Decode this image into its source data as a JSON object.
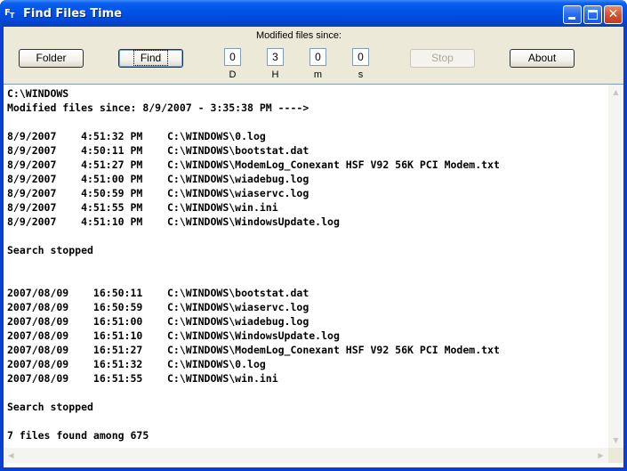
{
  "window": {
    "title": "Find Files Time",
    "icon": "app-icon",
    "controls": [
      "minimize-icon",
      "maximize-icon",
      "close-icon"
    ]
  },
  "toolbar": {
    "since_label": "Modified files since:",
    "folder_label": "Folder",
    "find_label": "Find",
    "stop_label": "Stop",
    "about_label": "About",
    "fields": [
      {
        "value": "0",
        "unit": "D"
      },
      {
        "value": "3",
        "unit": "H"
      },
      {
        "value": "0",
        "unit": "m"
      },
      {
        "value": "0",
        "unit": "s"
      }
    ]
  },
  "output": {
    "lines": [
      "C:\\WINDOWS",
      "Modified files since: 8/9/2007 - 3:35:38 PM ---->",
      "",
      "8/9/2007    4:51:32 PM    C:\\WINDOWS\\0.log",
      "8/9/2007    4:50:11 PM    C:\\WINDOWS\\bootstat.dat",
      "8/9/2007    4:51:27 PM    C:\\WINDOWS\\ModemLog_Conexant HSF V92 56K PCI Modem.txt",
      "8/9/2007    4:51:00 PM    C:\\WINDOWS\\wiadebug.log",
      "8/9/2007    4:50:59 PM    C:\\WINDOWS\\wiaservc.log",
      "8/9/2007    4:51:55 PM    C:\\WINDOWS\\win.ini",
      "8/9/2007    4:51:10 PM    C:\\WINDOWS\\WindowsUpdate.log",
      "",
      "Search stopped",
      "",
      "",
      "2007/08/09    16:50:11    C:\\WINDOWS\\bootstat.dat",
      "2007/08/09    16:50:59    C:\\WINDOWS\\wiaservc.log",
      "2007/08/09    16:51:00    C:\\WINDOWS\\wiadebug.log",
      "2007/08/09    16:51:10    C:\\WINDOWS\\WindowsUpdate.log",
      "2007/08/09    16:51:27    C:\\WINDOWS\\ModemLog_Conexant HSF V92 56K PCI Modem.txt",
      "2007/08/09    16:51:32    C:\\WINDOWS\\0.log",
      "2007/08/09    16:51:55    C:\\WINDOWS\\win.ini",
      "",
      "Search stopped",
      "",
      "7 files found among 675"
    ]
  },
  "scrollbars": {
    "up_icon": "arrow-up-icon",
    "down_icon": "arrow-down-icon",
    "left_icon": "arrow-left-icon",
    "right_icon": "arrow-right-icon"
  }
}
